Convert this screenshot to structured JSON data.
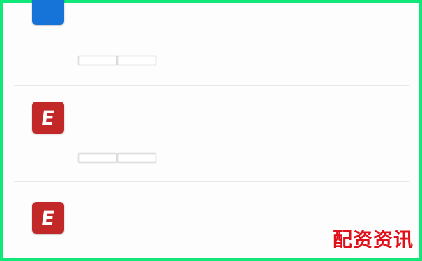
{
  "watermark": "配资资讯",
  "items": [
    {
      "icon": "blue-app-icon",
      "title": "",
      "body": [],
      "buttons": [],
      "meta": []
    },
    {
      "icon": "red-e-app-icon",
      "title": "",
      "body": [],
      "buttons": [],
      "meta": []
    },
    {
      "icon": "red-e-app-icon",
      "title": "",
      "body": [],
      "buttons": [],
      "meta": []
    }
  ],
  "icon_glyphs": {
    "blue-app-icon": "",
    "red-e-app-icon": "E"
  },
  "colors": {
    "frame": "#10e87a",
    "blue_icon": "#1673d8",
    "red_icon": "#c22828",
    "watermark": "#e0101a"
  }
}
